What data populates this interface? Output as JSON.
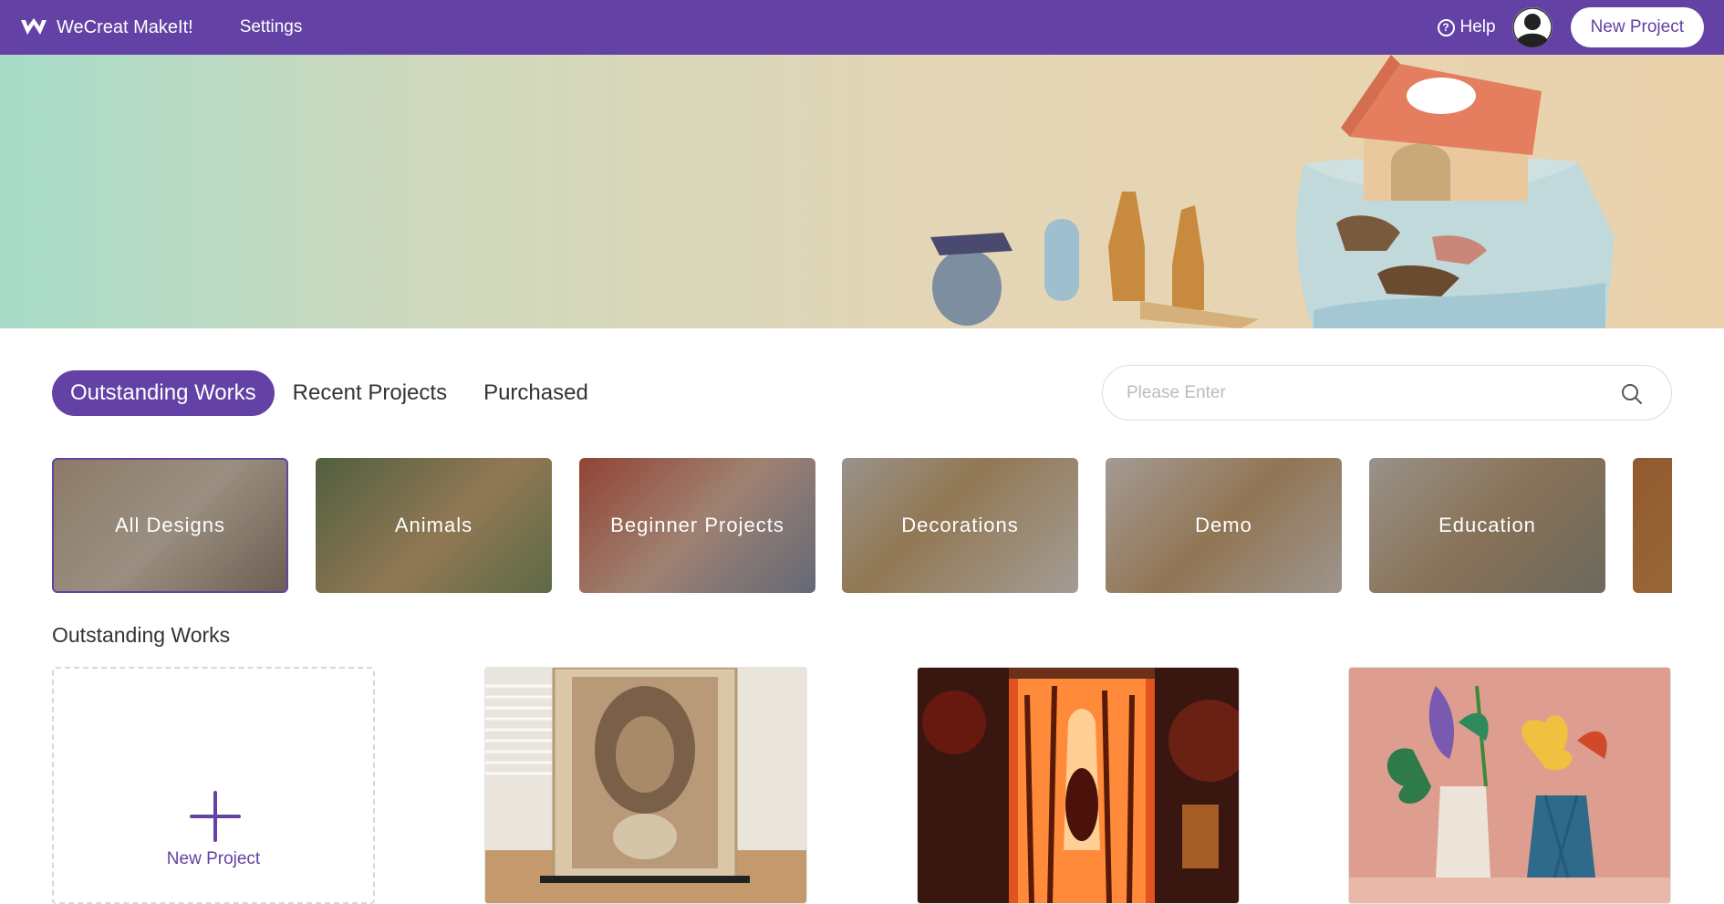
{
  "app": {
    "name": "WeCreat MakeIt!",
    "logo_icon": "wecreat-logo-icon"
  },
  "nav": {
    "settings_label": "Settings",
    "help_label": "Help",
    "new_project_label": "New Project"
  },
  "colors": {
    "brand": "#6441a5",
    "text": "#333333",
    "muted": "#bbbbbb"
  },
  "tabs": [
    {
      "label": "Outstanding Works",
      "active": true
    },
    {
      "label": "Recent Projects",
      "active": false
    },
    {
      "label": "Purchased",
      "active": false
    }
  ],
  "search": {
    "placeholder": "Please Enter",
    "value": ""
  },
  "categories": [
    {
      "label": "All Designs",
      "selected": true
    },
    {
      "label": "Animals",
      "selected": false
    },
    {
      "label": "Beginner Projects",
      "selected": false
    },
    {
      "label": "Decorations",
      "selected": false
    },
    {
      "label": "Demo",
      "selected": false
    },
    {
      "label": "Education",
      "selected": false
    }
  ],
  "section": {
    "title": "Outstanding Works",
    "new_project_label": "New Project"
  }
}
